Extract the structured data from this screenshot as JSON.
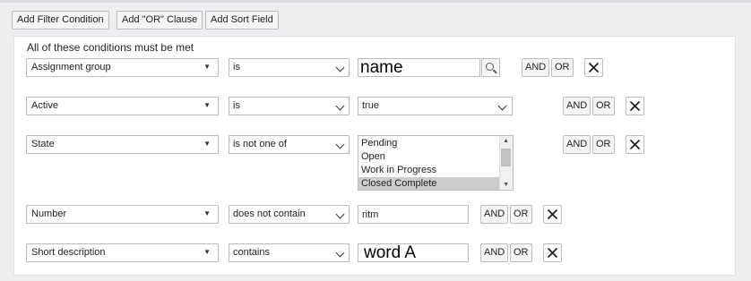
{
  "toolbar": {
    "add_filter_condition": "Add Filter Condition",
    "add_or_clause": "Add \"OR\" Clause",
    "add_sort_field": "Add Sort Field"
  },
  "panel": {
    "heading": "All of these conditions must be met"
  },
  "conditions": [
    {
      "field": "Assignment group",
      "operator": "is",
      "value_type": "reference",
      "value": "name",
      "and_label": "AND",
      "or_label": "OR",
      "icon": "search-icon"
    },
    {
      "field": "Active",
      "operator": "is",
      "value_type": "select",
      "value": "true",
      "and_label": "AND",
      "or_label": "OR"
    },
    {
      "field": "State",
      "operator": "is not one of",
      "value_type": "multiselect",
      "options": [
        "Pending",
        "Open",
        "Work in Progress",
        "Closed Complete"
      ],
      "selected": "Closed Complete",
      "and_label": "AND",
      "or_label": "OR"
    },
    {
      "field": "Number",
      "operator": "does not contain",
      "value_type": "text",
      "value": "ritm",
      "and_label": "AND",
      "or_label": "OR"
    },
    {
      "field": "Short description",
      "operator": "contains",
      "value_type": "text",
      "value": "word A",
      "and_label": "AND",
      "or_label": "OR"
    }
  ],
  "icons": {
    "field_dropdown": "caret-down-icon",
    "operator_dropdown": "chevron-down-icon",
    "delete": "close-icon",
    "lookup": "search-icon"
  },
  "colors": {
    "page_background": "#efeff1",
    "panel_background": "#ffffff",
    "selected_option": "#cccccc"
  }
}
